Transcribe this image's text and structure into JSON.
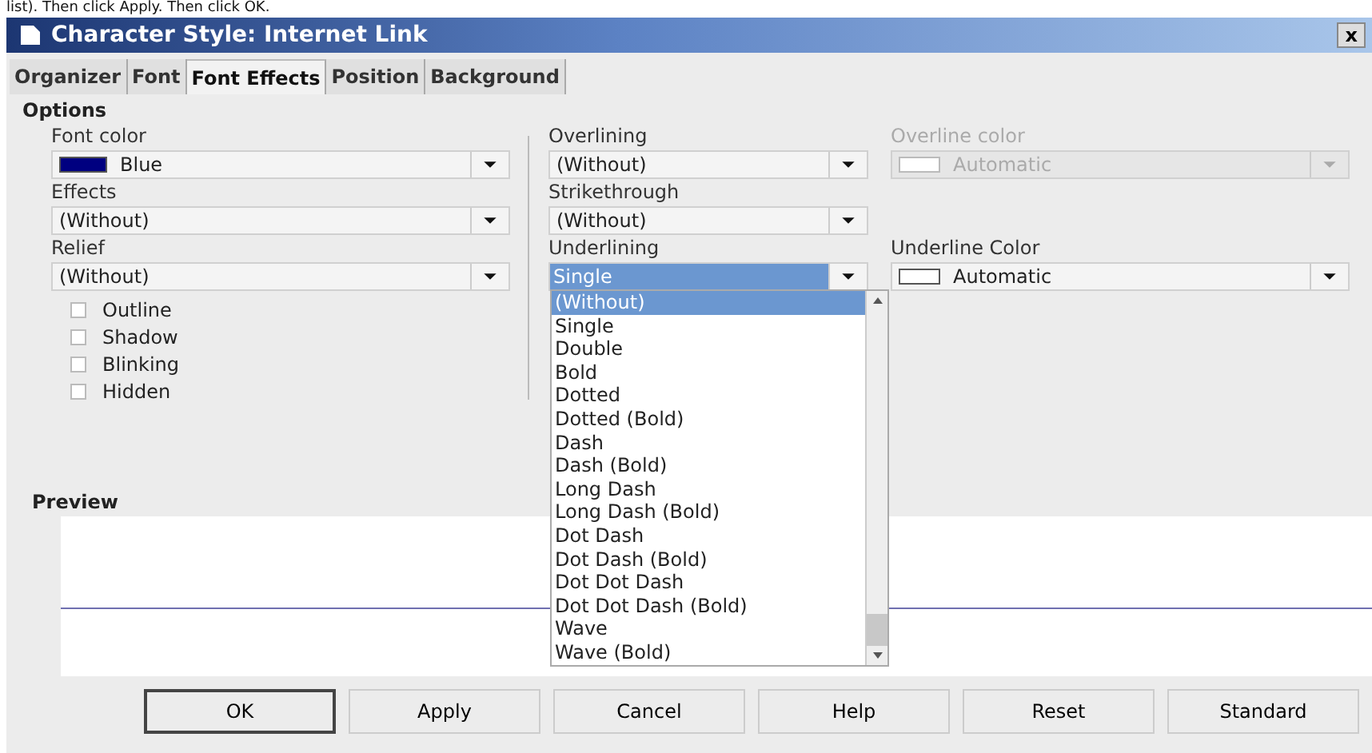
{
  "caption": "list). Then click Apply. Then click OK.",
  "window": {
    "title": "Character Style: Internet Link",
    "close_glyph": "x"
  },
  "tabs": [
    {
      "label": "Organizer",
      "selected": false
    },
    {
      "label": "Font",
      "selected": false
    },
    {
      "label": "Font Effects",
      "selected": true
    },
    {
      "label": "Position",
      "selected": false
    },
    {
      "label": "Background",
      "selected": false
    }
  ],
  "options_heading": "Options",
  "columns": [
    {
      "fields": [
        {
          "kind": "color",
          "label": "Font color",
          "value": "Blue",
          "color": "#000080",
          "disabled": false
        },
        {
          "kind": "text",
          "label": "Effects",
          "value": "(Without)",
          "disabled": false
        },
        {
          "kind": "text",
          "label": "Relief",
          "value": "(Without)",
          "disabled": false
        }
      ],
      "checkboxes": [
        {
          "label": "Outline",
          "checked": false
        },
        {
          "label": "Shadow",
          "checked": false
        },
        {
          "label": "Blinking",
          "checked": false
        },
        {
          "label": "Hidden",
          "checked": false
        }
      ]
    },
    {
      "fields": [
        {
          "kind": "text",
          "label": "Overlining",
          "value": "(Without)",
          "disabled": false
        },
        {
          "kind": "text",
          "label": "Strikethrough",
          "value": "(Without)",
          "disabled": false
        },
        {
          "kind": "open",
          "label": "Underlining",
          "value": "Single",
          "disabled": false
        }
      ]
    },
    {
      "fields": [
        {
          "kind": "color",
          "label": "Overline color",
          "value": "Automatic",
          "color": "#ffffff",
          "disabled": true
        },
        {
          "kind": "spacer"
        },
        {
          "kind": "color",
          "label": "Underline Color",
          "value": "Automatic",
          "color": "#ffffff",
          "disabled": false
        }
      ]
    }
  ],
  "underline_list": [
    {
      "label": "(Without)",
      "selected": true
    },
    {
      "label": "Single",
      "selected": false
    },
    {
      "label": "Double",
      "selected": false
    },
    {
      "label": "Bold",
      "selected": false
    },
    {
      "label": "Dotted",
      "selected": false
    },
    {
      "label": "Dotted (Bold)",
      "selected": false
    },
    {
      "label": "Dash",
      "selected": false
    },
    {
      "label": "Dash (Bold)",
      "selected": false
    },
    {
      "label": "Long Dash",
      "selected": false
    },
    {
      "label": "Long Dash (Bold)",
      "selected": false
    },
    {
      "label": "Dot Dash",
      "selected": false
    },
    {
      "label": "Dot Dash (Bold)",
      "selected": false
    },
    {
      "label": "Dot Dot Dash",
      "selected": false
    },
    {
      "label": "Dot Dot Dash (Bold)",
      "selected": false
    },
    {
      "label": "Wave",
      "selected": false
    },
    {
      "label": "Wave (Bold)",
      "selected": false
    }
  ],
  "preview": {
    "label": "Preview"
  },
  "buttons": [
    {
      "label": "OK",
      "default": true
    },
    {
      "label": "Apply",
      "default": false
    },
    {
      "label": "Cancel",
      "default": false
    },
    {
      "label": "Help",
      "default": false
    },
    {
      "label": "Reset",
      "default": false
    },
    {
      "label": "Standard",
      "default": false
    }
  ]
}
